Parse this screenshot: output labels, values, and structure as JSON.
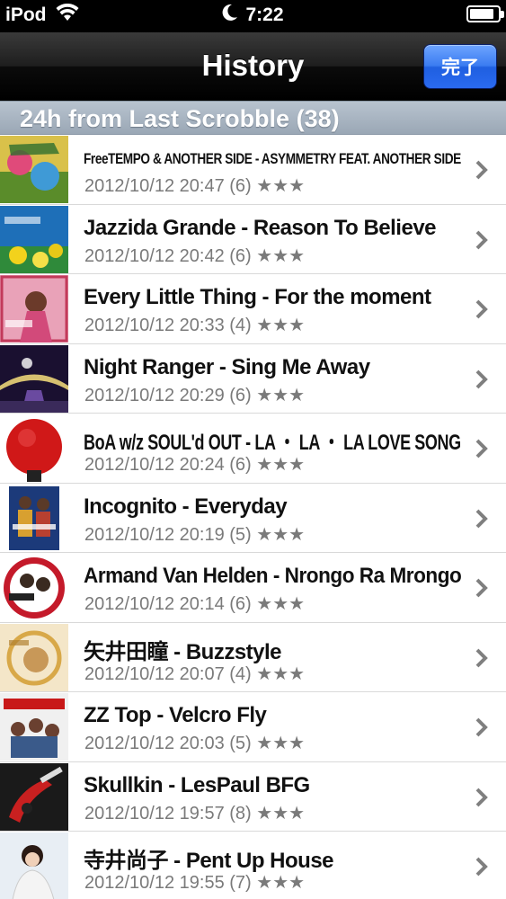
{
  "status_bar": {
    "carrier": "iPod",
    "time": "7:22",
    "icons": [
      "wifi-icon",
      "moon-icon",
      "battery-icon"
    ]
  },
  "nav": {
    "title": "History",
    "done_label": "完了"
  },
  "section": {
    "header": "24h from Last Scrobble (38)"
  },
  "rows": [
    {
      "title": "FreeTEMPO & ANOTHER SIDE - ASYMMETRY FEAT. ANOTHER SIDE",
      "subtitle": "2012/10/12 20:47 (6) ★★★",
      "art": "album-art-freetempo"
    },
    {
      "title": "Jazzida Grande - Reason To Believe",
      "subtitle": "2012/10/12 20:42 (6) ★★★",
      "art": "album-art-jazzida"
    },
    {
      "title": "Every Little Thing - For the moment",
      "subtitle": "2012/10/12 20:33 (4) ★★★",
      "art": "album-art-elt"
    },
    {
      "title": "Night Ranger - Sing Me Away",
      "subtitle": "2012/10/12 20:29 (6) ★★★",
      "art": "album-art-night-ranger"
    },
    {
      "title": "BoA w/z SOUL'd OUT - LA ・ LA ・ LA LOVE SONG",
      "subtitle": "2012/10/12 20:24 (6) ★★★",
      "art": "album-art-boa"
    },
    {
      "title": "Incognito - Everyday",
      "subtitle": "2012/10/12 20:19 (5) ★★★",
      "art": "album-art-incognito"
    },
    {
      "title": "Armand Van Helden - Nrongo Ra Mrongo",
      "subtitle": "2012/10/12 20:14 (6) ★★★",
      "art": "album-art-avh"
    },
    {
      "title": "矢井田瞳 - Buzzstyle",
      "subtitle": "2012/10/12 20:07 (4) ★★★",
      "art": "album-art-yaiida"
    },
    {
      "title": "ZZ Top - Velcro Fly",
      "subtitle": "2012/10/12 20:03 (5) ★★★",
      "art": "album-art-zztop"
    },
    {
      "title": "Skullkin - LesPaul BFG",
      "subtitle": "2012/10/12 19:57 (8) ★★★",
      "art": "album-art-skullkin"
    },
    {
      "title": "寺井尚子 - Pent Up House",
      "subtitle": "2012/10/12 19:55 (7) ★★★",
      "art": "album-art-terai"
    }
  ]
}
